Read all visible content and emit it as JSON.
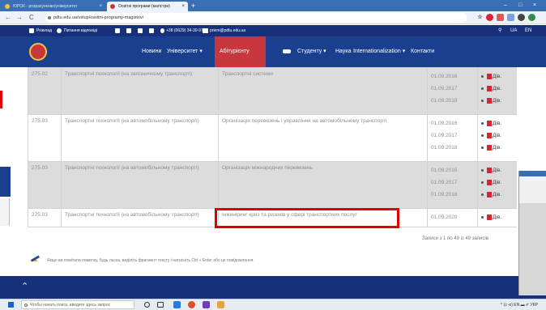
{
  "browser": {
    "tabs": [
      {
        "label": "ЮРОК - розрахункове/університет",
        "close": "×",
        "active": false
      },
      {
        "label": "Освітні програми (магістри)",
        "close": "×",
        "active": true
      }
    ],
    "new_tab": "+",
    "window_controls": [
      "–",
      "□",
      "×"
    ],
    "nav": {
      "back": "←",
      "forward": "→",
      "reload": "C"
    },
    "url": "pdtu.edu.ua/vstup/osvitni-programy-magistriv/",
    "star": "☆"
  },
  "topbar": {
    "items": [
      "Розклад",
      "Питання відповіді",
      "+38 (0629) 34-30-97",
      "priem@pdtu.edu.ua"
    ],
    "right": [
      "UA",
      "EN"
    ]
  },
  "nav": {
    "items": [
      "Новини",
      "Університет ▾",
      "Абітурієнту",
      "Студенту ▾",
      "Наука",
      "Internationalization ▾",
      "Контакти"
    ],
    "active_index": 2,
    "accent": "#c8373d",
    "bg": "#1a3f8f"
  },
  "table": {
    "rows": [
      {
        "code": "275.02",
        "spec": "Транспортні технології (на залізничному транспорті)",
        "prog": "Транспортні системи",
        "dates": [
          "01.09.2016",
          "01.09.2017",
          "01.09.2018"
        ],
        "files": [
          "Дів.",
          "Дів.",
          "Дів."
        ],
        "shaded": true
      },
      {
        "code": "275.03",
        "spec": "Транспортні технології (на автомобільному транспорті)",
        "prog": "Організація перевезень і управління на автомобільному транспорті",
        "dates": [
          "01.09.2016",
          "01.09.2017",
          "01.09.2018"
        ],
        "files": [
          "Дів.",
          "Дів.",
          "Дів."
        ],
        "shaded": false
      },
      {
        "code": "275.03",
        "spec": "Транспортні технології (на автомобільному транспорті)",
        "prog": "Організація міжнародних перевезень",
        "dates": [
          "01.09.2016",
          "01.09.2017",
          "01.09.2018"
        ],
        "files": [
          "Дів.",
          "Дів.",
          "Дів."
        ],
        "shaded": true
      },
      {
        "code": "275.03",
        "spec": "Транспортні технології (на автомобільному транспорті)",
        "prog": "Інжиніринг криз та ризиків у сфері транспортних послуг",
        "dates": [
          "01.09.2020"
        ],
        "files": [
          "Дів."
        ],
        "shaded": false
      }
    ],
    "records_info": "Записи з 1 по 49 із 49 записів"
  },
  "feedback_note": "Якщо ви помітили помилку, будь ласка, виділіть фрагмент тексту і натисніть Ctrl + Enter або це повідомлення.",
  "footer": {
    "to_top": "⌃"
  },
  "taskbar": {
    "search_placeholder": "Чтобы начать поиск, введите здесь запрос",
    "tray": "^ ⊡ ⊲) EN ▬ ✐ УКР"
  },
  "colors": {
    "highlight": "#e00000",
    "header_blue": "#16307a",
    "pdf_red": "#d9232e"
  }
}
